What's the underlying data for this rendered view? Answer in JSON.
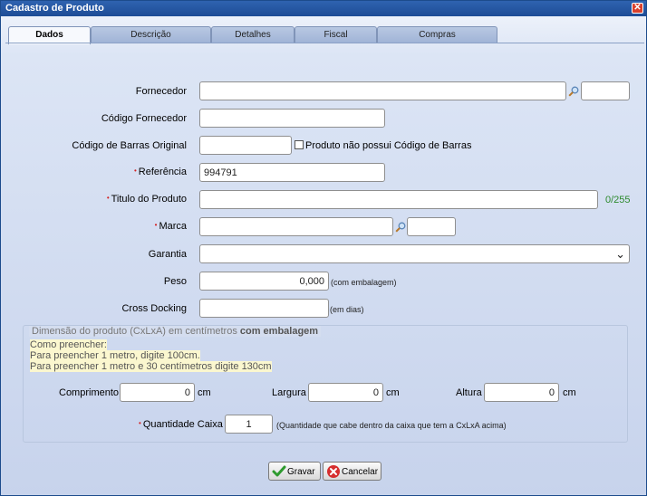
{
  "window": {
    "title": "Cadastro de Produto",
    "close_icon": "close-icon"
  },
  "tabs": [
    {
      "label": "Dados",
      "active": true
    },
    {
      "label": "Descrição",
      "active": false
    },
    {
      "label": "Detalhes",
      "active": false
    },
    {
      "label": "Fiscal",
      "active": false
    },
    {
      "label": "Compras",
      "active": false
    }
  ],
  "form": {
    "fornecedor": {
      "label": "Fornecedor",
      "value": "",
      "code": ""
    },
    "codigo_fornecedor": {
      "label": "Código Fornecedor",
      "value": ""
    },
    "codigo_barras": {
      "label": "Código de Barras Original",
      "value": "",
      "no_barcode_label": "Produto não possui Código de Barras"
    },
    "referencia": {
      "label": "Referência",
      "value": "994791",
      "required_mark": "•"
    },
    "titulo": {
      "label": "Titulo do Produto",
      "value": "",
      "counter": "0/255",
      "required_mark": "•"
    },
    "marca": {
      "label": "Marca",
      "value": "",
      "code": "",
      "required_mark": "•"
    },
    "garantia": {
      "label": "Garantia",
      "value": ""
    },
    "peso": {
      "label": "Peso",
      "value": "0,000",
      "note": "(com embalagem)"
    },
    "cross_docking": {
      "label": "Cross Docking",
      "value": "",
      "note": "(em dias)"
    }
  },
  "dimensions": {
    "legend_text": "Dimensão do produto (CxLxA) em centímetros ",
    "legend_bold": "com embalagem",
    "hints": [
      "Como preencher:",
      "Para preencher 1 metro, digite 100cm.",
      "Para preencher 1 metro e 30 centímetros digite 130cm"
    ],
    "comprimento": {
      "label": "Comprimento",
      "value": "0",
      "unit": "cm"
    },
    "largura": {
      "label": "Largura",
      "value": "0",
      "unit": "cm"
    },
    "altura": {
      "label": "Altura",
      "value": "0",
      "unit": "cm"
    },
    "quantidade": {
      "label": "Quantidade Caixa",
      "value": "1",
      "required_mark": "•",
      "note": "(Quantidade que cabe dentro da caixa que tem a CxLxA acima)"
    }
  },
  "buttons": {
    "save": "Gravar",
    "cancel": "Cancelar"
  },
  "colors": {
    "titlebar": "#1d4c96",
    "required": "#d42020",
    "counter": "#2d8a2d",
    "hint_bg": "#fbf7cf"
  }
}
